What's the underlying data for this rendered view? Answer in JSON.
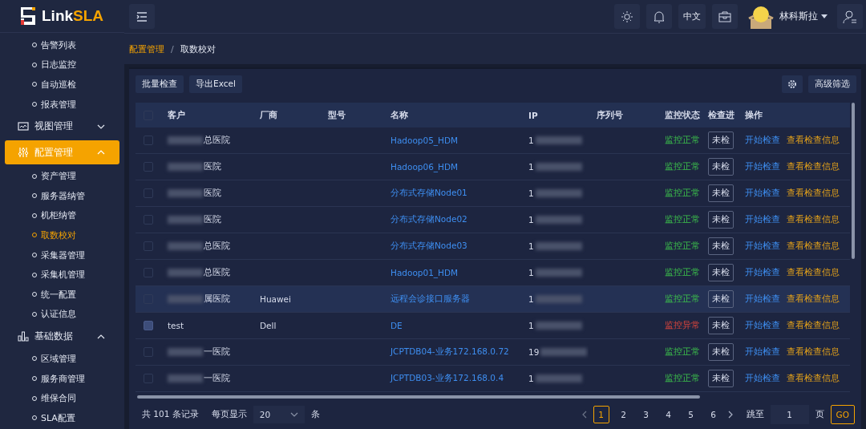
{
  "logo": {
    "text_a": "Link",
    "text_b": "SLA"
  },
  "sidebar": {
    "items": [
      {
        "kind": "sub",
        "label": "告警列表",
        "selected": false
      },
      {
        "kind": "sub",
        "label": "日志监控",
        "selected": false
      },
      {
        "kind": "sub",
        "label": "自动巡检",
        "selected": false
      },
      {
        "kind": "sub",
        "label": "报表管理",
        "selected": false
      },
      {
        "kind": "group",
        "label": "视图管理",
        "expanded": false,
        "selected": false
      },
      {
        "kind": "group",
        "label": "配置管理",
        "expanded": true,
        "selected": true
      },
      {
        "kind": "sub",
        "label": "资产管理",
        "selected": false
      },
      {
        "kind": "sub",
        "label": "服务器纳管",
        "selected": false
      },
      {
        "kind": "sub",
        "label": "机柜纳管",
        "selected": false
      },
      {
        "kind": "sub",
        "label": "取数校对",
        "selected": true
      },
      {
        "kind": "sub",
        "label": "采集器管理",
        "selected": false
      },
      {
        "kind": "sub",
        "label": "采集机管理",
        "selected": false
      },
      {
        "kind": "sub",
        "label": "统一配置",
        "selected": false
      },
      {
        "kind": "sub",
        "label": "认证信息",
        "selected": false
      },
      {
        "kind": "group",
        "label": "基础数据",
        "expanded": true,
        "selected": false
      },
      {
        "kind": "sub",
        "label": "区域管理",
        "selected": false
      },
      {
        "kind": "sub",
        "label": "服务商管理",
        "selected": false
      },
      {
        "kind": "sub",
        "label": "维保合同",
        "selected": false
      },
      {
        "kind": "sub",
        "label": "SLA配置",
        "selected": false
      }
    ]
  },
  "topbar": {
    "language": "中文",
    "user": "林科斯拉"
  },
  "breadcrumb": {
    "items": [
      "配置管理",
      "取数校对"
    ],
    "separator": "/"
  },
  "toolbar": {
    "buttons": [
      "批量检查",
      "导出Excel"
    ],
    "filter": "高级筛选"
  },
  "table": {
    "select_all_checked": false,
    "columns": [
      "客户",
      "厂商",
      "型号",
      "名称",
      "IP",
      "序列号",
      "监控状态",
      "检查进",
      "操作"
    ],
    "rows": [
      {
        "customer": "总医院",
        "masked": true,
        "name": "Hadoop05_HDM",
        "ip": "1",
        "status": "监控正常",
        "ok": true,
        "check": "未检",
        "action_a": "开始检查",
        "action_b": "查看检查信息",
        "checked": false,
        "highlighted": false
      },
      {
        "customer": "医院",
        "masked": true,
        "name": "Hadoop06_HDM",
        "ip": "1",
        "status": "监控正常",
        "ok": true,
        "check": "未检",
        "action_a": "开始检查",
        "action_b": "查看检查信息",
        "checked": false,
        "highlighted": false
      },
      {
        "customer": "医院",
        "masked": true,
        "name": "分布式存储Node01",
        "ip": "1",
        "status": "监控正常",
        "ok": true,
        "check": "未检",
        "action_a": "开始检查",
        "action_b": "查看检查信息",
        "checked": false,
        "highlighted": false
      },
      {
        "customer": "医院",
        "masked": true,
        "name": "分布式存储Node02",
        "ip": "1",
        "status": "监控正常",
        "ok": true,
        "check": "未检",
        "action_a": "开始检查",
        "action_b": "查看检查信息",
        "checked": false,
        "highlighted": false
      },
      {
        "customer": "总医院",
        "masked": true,
        "name": "分布式存储Node03",
        "ip": "1",
        "status": "监控正常",
        "ok": true,
        "check": "未检",
        "action_a": "开始检查",
        "action_b": "查看检查信息",
        "checked": false,
        "highlighted": false
      },
      {
        "customer": "总医院",
        "masked": true,
        "name": "Hadoop01_HDM",
        "ip": "1",
        "status": "监控正常",
        "ok": true,
        "check": "未检",
        "action_a": "开始检查",
        "action_b": "查看检查信息",
        "checked": false,
        "highlighted": false
      },
      {
        "customer": "属医院",
        "masked": true,
        "vendor": "Huawei",
        "name": "远程会诊接口服务器",
        "ip": "1",
        "status": "监控正常",
        "ok": true,
        "check": "未检",
        "action_a": "开始检查",
        "action_b": "查看检查信息",
        "checked": false,
        "highlighted": true
      },
      {
        "customer": "test",
        "masked": false,
        "vendor": "Dell",
        "name": "DE",
        "ip": "1",
        "status": "监控异常",
        "ok": false,
        "check": "未检",
        "action_a": "开始检查",
        "action_b": "查看检查信息",
        "checked": true,
        "highlighted": false
      },
      {
        "customer": "一医院",
        "masked": true,
        "name": "JCPTDB04-业务172.168.0.72",
        "ip": "19",
        "status": "监控正常",
        "ok": true,
        "check": "未检",
        "action_a": "开始检查",
        "action_b": "查看检查信息",
        "checked": false,
        "highlighted": false
      },
      {
        "customer": "一医院",
        "masked": true,
        "name": "JCPTDB03-业务172.168.0.4",
        "ip": "1",
        "status": "监控正常",
        "ok": true,
        "check": "未检",
        "action_a": "开始检查",
        "action_b": "查看检查信息",
        "checked": false,
        "highlighted": false
      }
    ]
  },
  "pagination": {
    "total": "共 101 条记录",
    "per_page_label": "每页显示",
    "per_page": "20",
    "unit": "条",
    "pages": [
      {
        "label": "1",
        "selected": true
      },
      {
        "label": "2",
        "selected": false
      },
      {
        "label": "3",
        "selected": false
      },
      {
        "label": "4",
        "selected": false
      },
      {
        "label": "5",
        "selected": false
      },
      {
        "label": "6",
        "selected": false
      }
    ],
    "jump_label": "跳至",
    "jump_value": "1",
    "page_unit": "页",
    "go": "GO"
  }
}
